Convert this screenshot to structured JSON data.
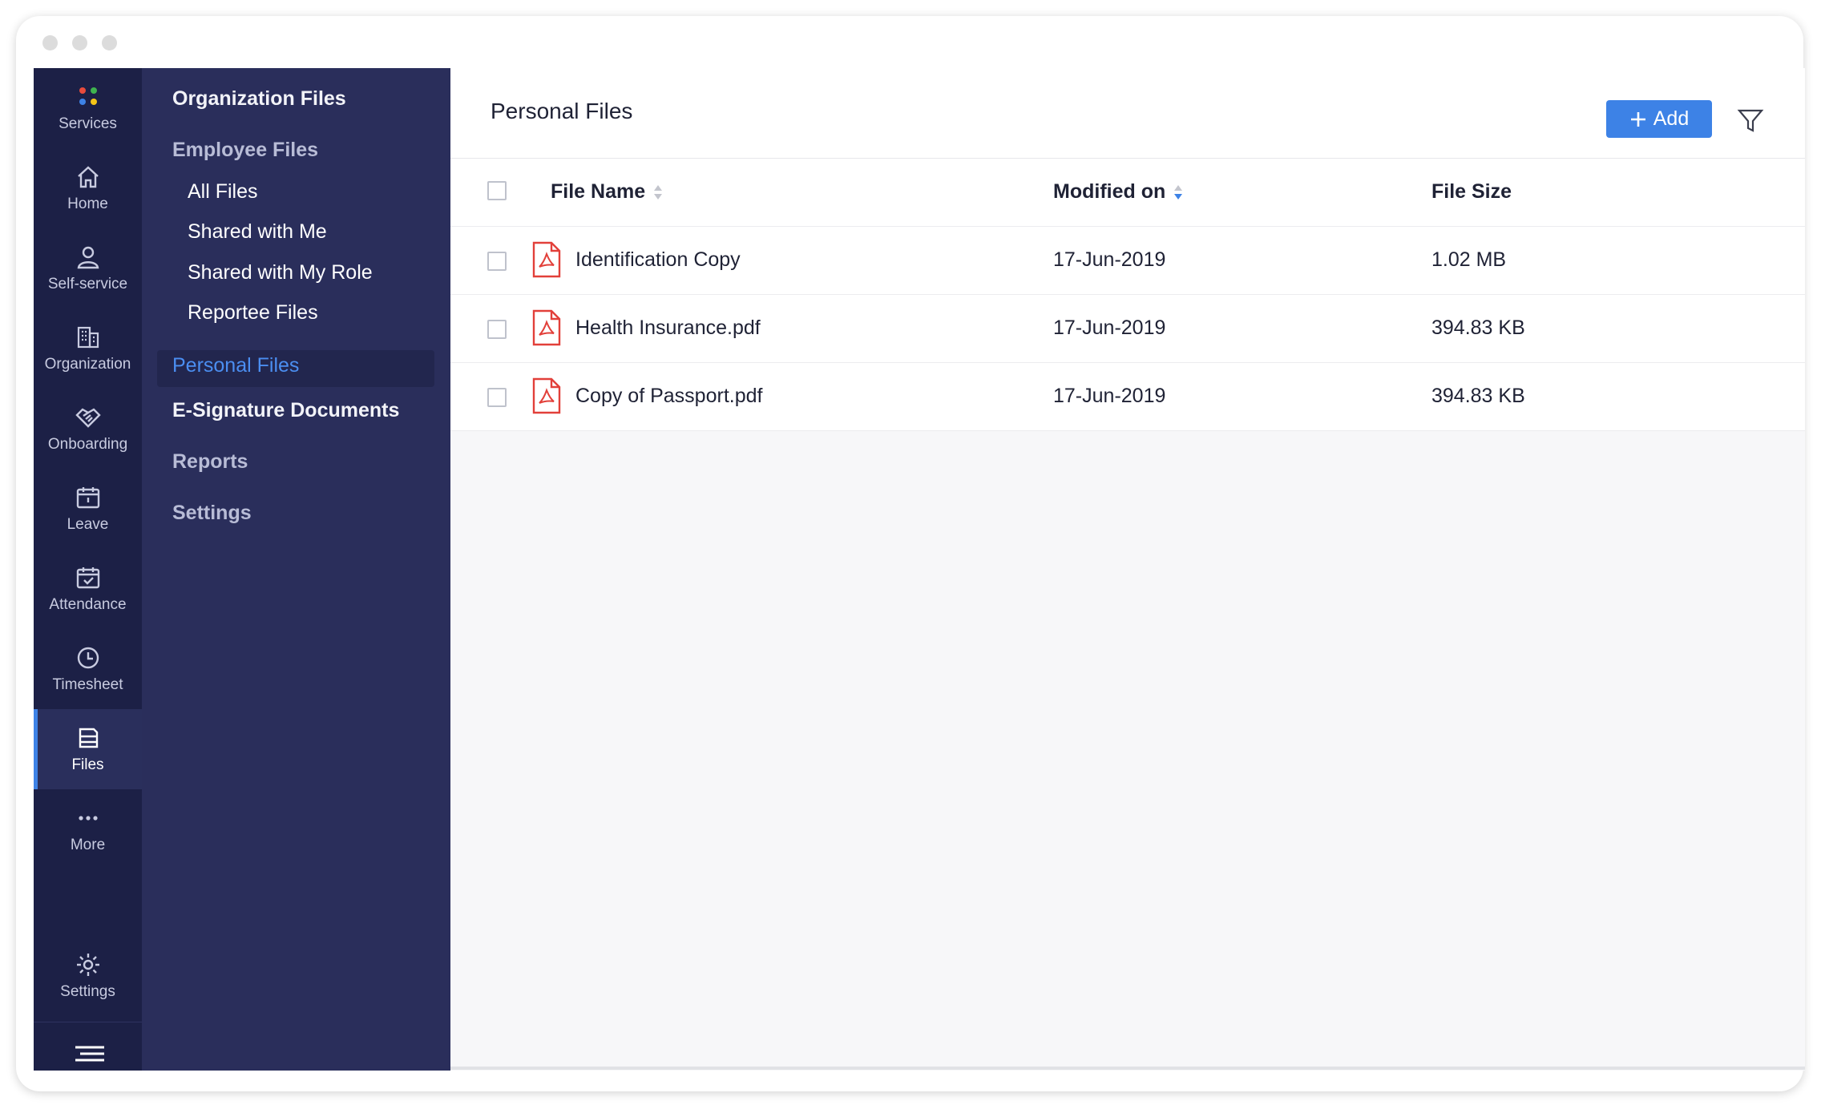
{
  "rail": {
    "items": [
      {
        "id": "services",
        "label": "Services",
        "icon": "services-grid-icon"
      },
      {
        "id": "home",
        "label": "Home",
        "icon": "home-icon"
      },
      {
        "id": "self-service",
        "label": "Self-service",
        "icon": "user-icon"
      },
      {
        "id": "organization",
        "label": "Organization",
        "icon": "building-icon"
      },
      {
        "id": "onboarding",
        "label": "Onboarding",
        "icon": "handshake-icon"
      },
      {
        "id": "leave",
        "label": "Leave",
        "icon": "calendar-icon"
      },
      {
        "id": "attendance",
        "label": "Attendance",
        "icon": "calendar-check-icon"
      },
      {
        "id": "timesheet",
        "label": "Timesheet",
        "icon": "clock-icon"
      },
      {
        "id": "files",
        "label": "Files",
        "icon": "files-icon",
        "active": true
      },
      {
        "id": "more",
        "label": "More",
        "icon": "more-dots-icon"
      }
    ],
    "settings_label": "Settings",
    "accent_color": "#3d82e6"
  },
  "subnav": {
    "organization_files": "Organization Files",
    "employee_files": "Employee Files",
    "all_files": "All Files",
    "shared_with_me": "Shared with Me",
    "shared_with_my_role": "Shared with My Role",
    "reportee_files": "Reportee Files",
    "personal_files": "Personal Files",
    "esignature": "E-Signature Documents",
    "reports": "Reports",
    "settings": "Settings"
  },
  "main": {
    "title": "Personal Files",
    "add_label": "Add",
    "columns": {
      "name": "File Name",
      "modified": "Modified on",
      "size": "File Size"
    },
    "rows": [
      {
        "name": "Identification Copy",
        "modified": "17-Jun-2019",
        "size": "1.02 MB"
      },
      {
        "name": "Health Insurance.pdf",
        "modified": "17-Jun-2019",
        "size": "394.83 KB"
      },
      {
        "name": "Copy of Passport.pdf",
        "modified": "17-Jun-2019",
        "size": "394.83 KB"
      }
    ]
  }
}
